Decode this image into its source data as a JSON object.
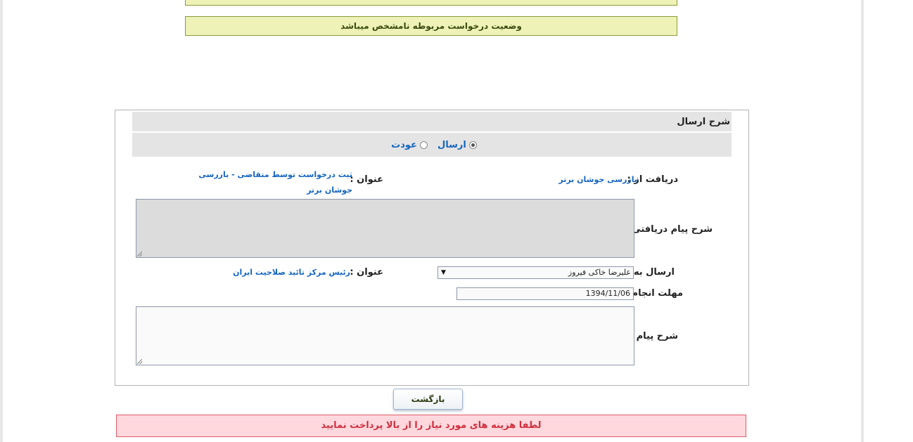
{
  "status_banner": {
    "text": "وضعیت درخواست مربوطه نامشخص میباشد"
  },
  "panel": {
    "title": "شرح ارسال",
    "radio_options": [
      {
        "label": "ارسال",
        "checked": true
      },
      {
        "label": "عودت",
        "checked": false
      }
    ],
    "received_from": {
      "label": "دریافت از :",
      "value": "بازرسی جوشان برتر"
    },
    "received_title": {
      "label": "عنوان :",
      "value": "ثبت درخواست توسط متقاضی - بازرسی جوشان برتر"
    },
    "received_message": {
      "label": "شرح پیام دریافتی :",
      "value": ""
    },
    "send_to": {
      "label": "ارسال به :",
      "value": "علیرضا خاکی فیروز"
    },
    "send_title": {
      "label": "عنوان :",
      "value": "رئیس مرکز تائید صلاحیت ایران"
    },
    "deadline": {
      "label": "مهلت انجام:",
      "value": "1394/11/06"
    },
    "message": {
      "label": "شرح پیام :",
      "value": ""
    }
  },
  "back_button": {
    "label": "بازگشت"
  },
  "error": {
    "text": "لطفا هزینه های مورد نیاز را از بالا پرداخت نمایید"
  },
  "colors": {
    "banner_bg": "#eef2b6",
    "link_blue": "#1565c0",
    "error_bg": "#ffd8de",
    "error_text": "#d0303e"
  }
}
